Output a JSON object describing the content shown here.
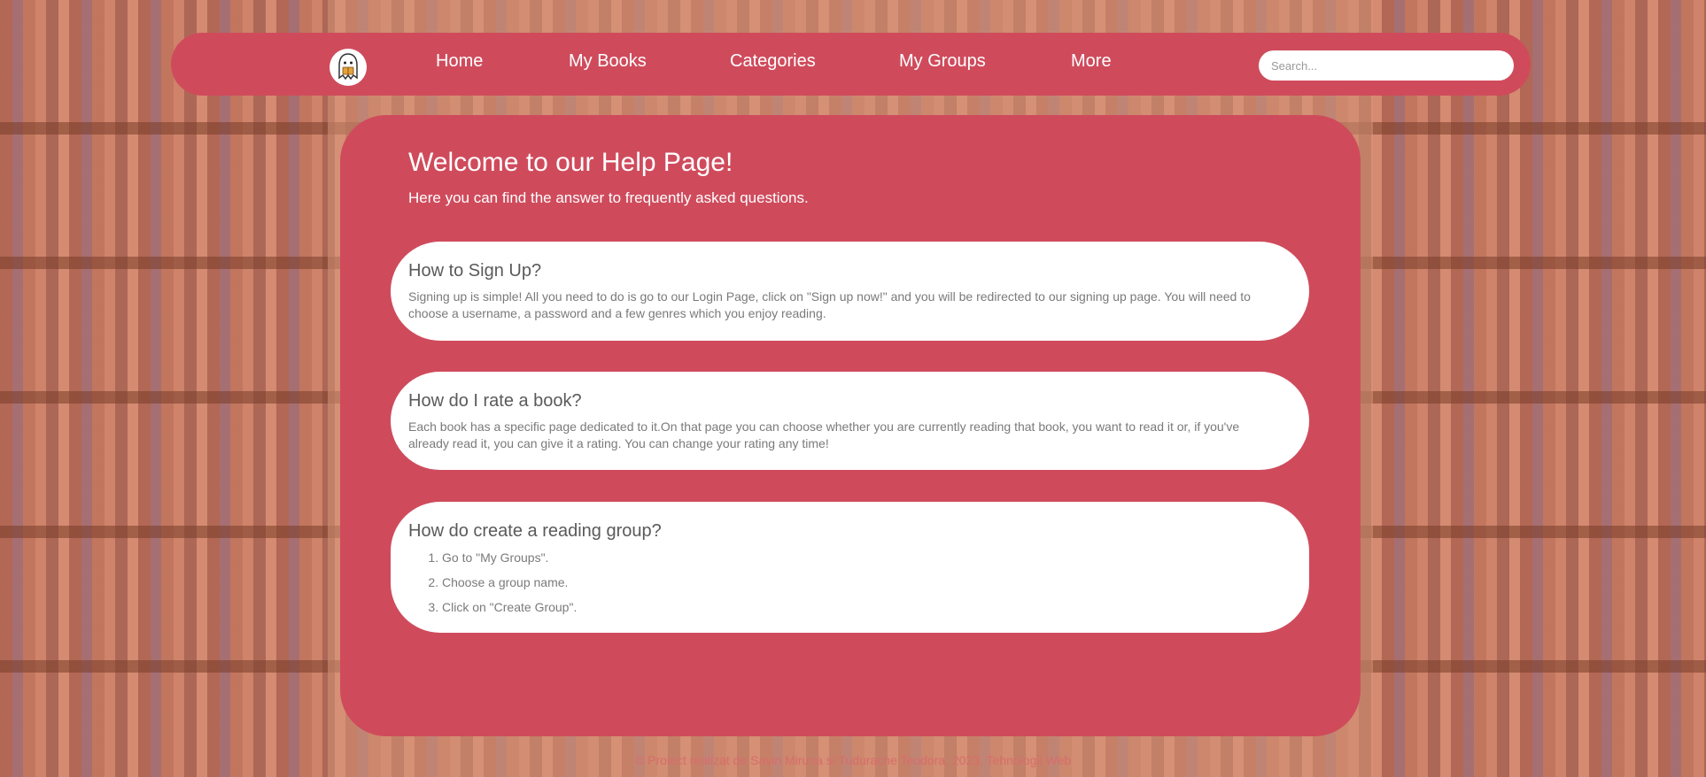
{
  "nav": {
    "items": [
      "Home",
      "My Books",
      "Categories",
      "My Groups",
      "More"
    ],
    "search_placeholder": "Search..."
  },
  "hero": {
    "title": "Welcome to our Help Page!",
    "subtitle": "Here you can find the answer to frequently asked questions."
  },
  "faq": [
    {
      "question": "How to Sign Up?",
      "answer": "Signing up is simple! All you need to do is go to our Login Page, click on \"Sign up now!\" and you will be redirected to our signing up page. You will need to choose a username, a password and a few genres which you enjoy reading."
    },
    {
      "question": "How do I rate a book?",
      "answer": "Each book has a specific page dedicated to it.On that page you can choose whether you are currently reading that book, you want to read it or, if you've already read it, you can give it a rating. You can change your rating any time!"
    },
    {
      "question": "How do create a reading group?",
      "steps": [
        "Go to \"My Groups\".",
        "Choose a group name.",
        "Click on \"Create Group\"."
      ]
    }
  ],
  "footer": {
    "text": "© Proiect realizat de Savin Miruna si Tudurache Teodora, 2023, Tehnologii Web"
  },
  "colors": {
    "primary": "#cf4b5c",
    "card": "#ffffff"
  },
  "icons": {
    "logo": "ghost-reading-logo-icon"
  }
}
